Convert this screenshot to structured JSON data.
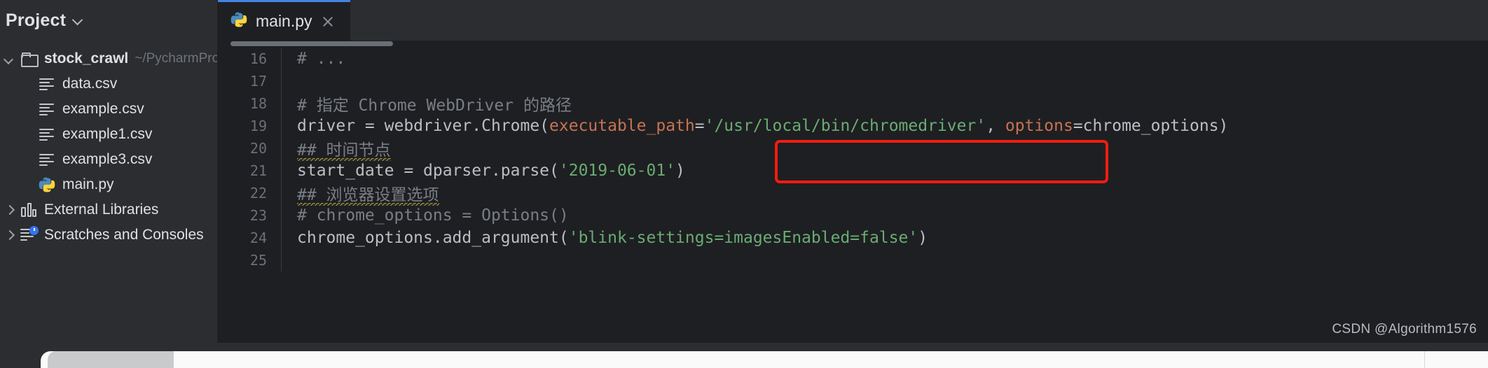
{
  "app": {
    "accent_color": "#4682e5",
    "background": "#2b2d30",
    "editor_background": "#1e1f22"
  },
  "sidebar": {
    "title": "Project",
    "toggle_icon": "chevron-down-icon",
    "tree": [
      {
        "label": "stock_crawl",
        "hint": "~/PycharmPro",
        "icon": "folder-icon",
        "arrow": "chevron-down-icon",
        "level": 0,
        "bold": true
      },
      {
        "label": "data.csv",
        "hint": "",
        "icon": "csv-file-icon",
        "arrow": "",
        "level": 1,
        "bold": false
      },
      {
        "label": "example.csv",
        "hint": "",
        "icon": "csv-file-icon",
        "arrow": "",
        "level": 1,
        "bold": false
      },
      {
        "label": "example1.csv",
        "hint": "",
        "icon": "csv-file-icon",
        "arrow": "",
        "level": 1,
        "bold": false
      },
      {
        "label": "example3.csv",
        "hint": "",
        "icon": "csv-file-icon",
        "arrow": "",
        "level": 1,
        "bold": false
      },
      {
        "label": "main.py",
        "hint": "",
        "icon": "python-file-icon",
        "arrow": "",
        "level": 1,
        "bold": false
      },
      {
        "label": "External Libraries",
        "hint": "",
        "icon": "library-icon",
        "arrow": "chevron-right-icon",
        "level": 0,
        "bold": false
      },
      {
        "label": "Scratches and Consoles",
        "hint": "",
        "icon": "scratches-icon",
        "arrow": "chevron-right-icon",
        "level": 0,
        "bold": false
      }
    ]
  },
  "editor": {
    "tabs": [
      {
        "label": "main.py",
        "icon": "python-file-icon",
        "close_icon": "close-icon",
        "active": true
      }
    ],
    "scrollbar": {
      "orientation": "horizontal",
      "position": "top"
    },
    "lines": [
      {
        "number": "16",
        "tokens": [
          {
            "text": "# ...",
            "type": "comment"
          }
        ]
      },
      {
        "number": "17",
        "tokens": []
      },
      {
        "number": "18",
        "tokens": [
          {
            "text": "# 指定 Chrome WebDriver 的路径",
            "type": "comment"
          }
        ]
      },
      {
        "number": "19",
        "tokens": [
          {
            "text": "driver = webdriver.Chrome(",
            "type": "plain"
          },
          {
            "text": "executable_path",
            "type": "kwarg"
          },
          {
            "text": "=",
            "type": "plain"
          },
          {
            "text": "'/usr/local/bin/chromedriver'",
            "type": "string"
          },
          {
            "text": ", ",
            "type": "plain"
          },
          {
            "text": "options",
            "type": "kwarg"
          },
          {
            "text": "=chrome_options)",
            "type": "plain"
          }
        ]
      },
      {
        "number": "20",
        "tokens": [
          {
            "text": "## 时间节点",
            "type": "comment",
            "squiggle": true
          }
        ]
      },
      {
        "number": "21",
        "tokens": [
          {
            "text": "start_date = dparser.parse(",
            "type": "plain"
          },
          {
            "text": "'2019-06-01'",
            "type": "string"
          },
          {
            "text": ")",
            "type": "plain"
          }
        ]
      },
      {
        "number": "22",
        "tokens": [
          {
            "text": "## 浏览器设置选项",
            "type": "comment",
            "squiggle": true
          }
        ]
      },
      {
        "number": "23",
        "tokens": [
          {
            "text": "# chrome_options = Options()",
            "type": "comment"
          }
        ]
      },
      {
        "number": "24",
        "tokens": [
          {
            "text": "chrome_options.add_argument(",
            "type": "plain"
          },
          {
            "text": "'blink-settings=imagesEnabled=false'",
            "type": "string"
          },
          {
            "text": ")",
            "type": "plain"
          }
        ]
      },
      {
        "number": "25",
        "tokens": []
      }
    ],
    "highlight_box": {
      "color": "#f11c0f",
      "covers": "executable_path='/usr/local/bin/chromedriver', options"
    }
  },
  "watermark": "CSDN @Algorithm1576"
}
